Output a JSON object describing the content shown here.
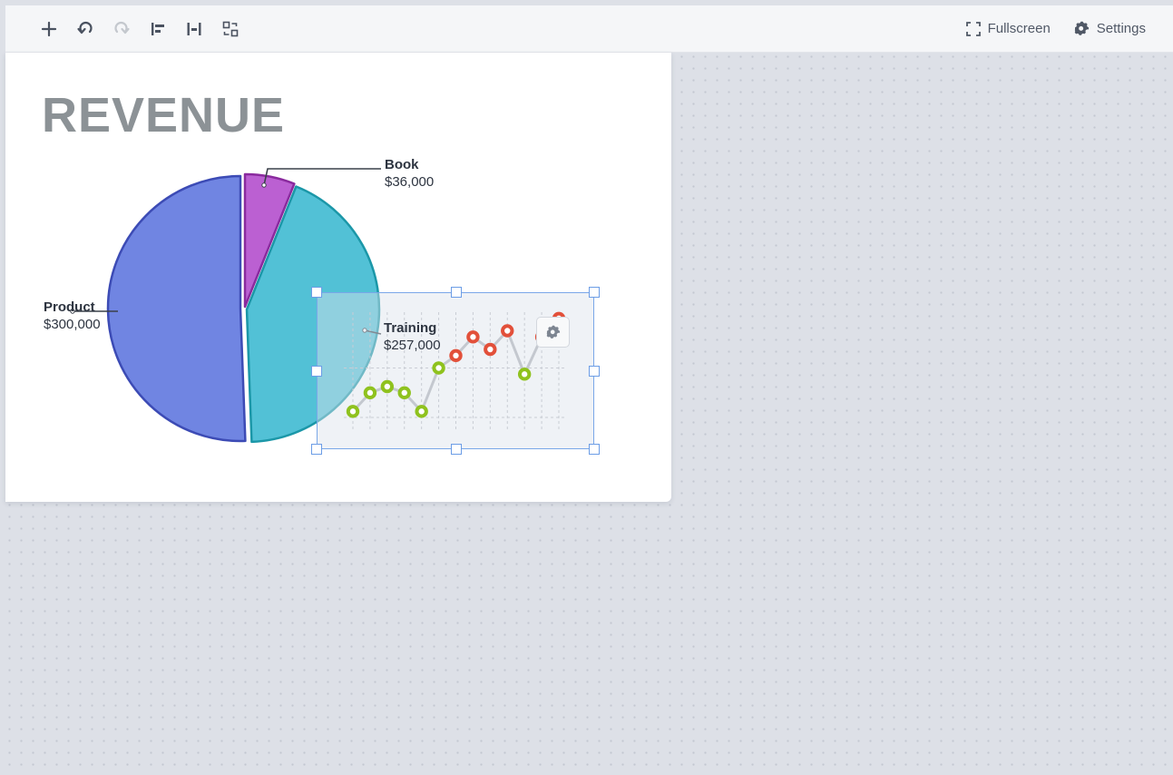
{
  "toolbar": {
    "left_buttons": [
      {
        "name": "add-icon",
        "label": "Add"
      },
      {
        "name": "undo-icon",
        "label": "Undo"
      },
      {
        "name": "redo-icon",
        "label": "Redo"
      },
      {
        "name": "align-left-icon",
        "label": "Align left"
      },
      {
        "name": "align-center-icon",
        "label": "Align center"
      },
      {
        "name": "arrange-icon",
        "label": "Arrange"
      }
    ],
    "fullscreen_label": "Fullscreen",
    "settings_label": "Settings"
  },
  "slide": {
    "title": "REVENUE"
  },
  "colors": {
    "product": "#7085e2",
    "training": "#52c1d6",
    "book": "#bb60d2",
    "line_green": "#8fc21e",
    "line_red": "#e2503a"
  },
  "chart_data": [
    {
      "type": "pie",
      "title": "REVENUE",
      "slices": [
        {
          "label": "Product",
          "value": 300000,
          "display": "$300,000",
          "color": "#7085e2"
        },
        {
          "label": "Training",
          "value": 257000,
          "display": "$257,000",
          "color": "#52c1d6"
        },
        {
          "label": "Book",
          "value": 36000,
          "display": "$36,000",
          "color": "#bb60d2"
        }
      ]
    },
    {
      "type": "line",
      "title": "",
      "x": [
        1,
        2,
        3,
        4,
        5,
        6,
        7,
        8,
        9,
        10,
        11,
        12,
        13
      ],
      "series": [
        {
          "values": [
            2,
            5,
            6,
            5,
            2,
            9,
            11,
            14,
            12,
            15,
            8,
            14,
            17
          ]
        }
      ],
      "point_colors": [
        "green",
        "green",
        "green",
        "green",
        "green",
        "green",
        "red",
        "red",
        "red",
        "red",
        "green",
        "red",
        "red"
      ],
      "ylim": [
        0,
        18
      ],
      "grid": true
    }
  ]
}
